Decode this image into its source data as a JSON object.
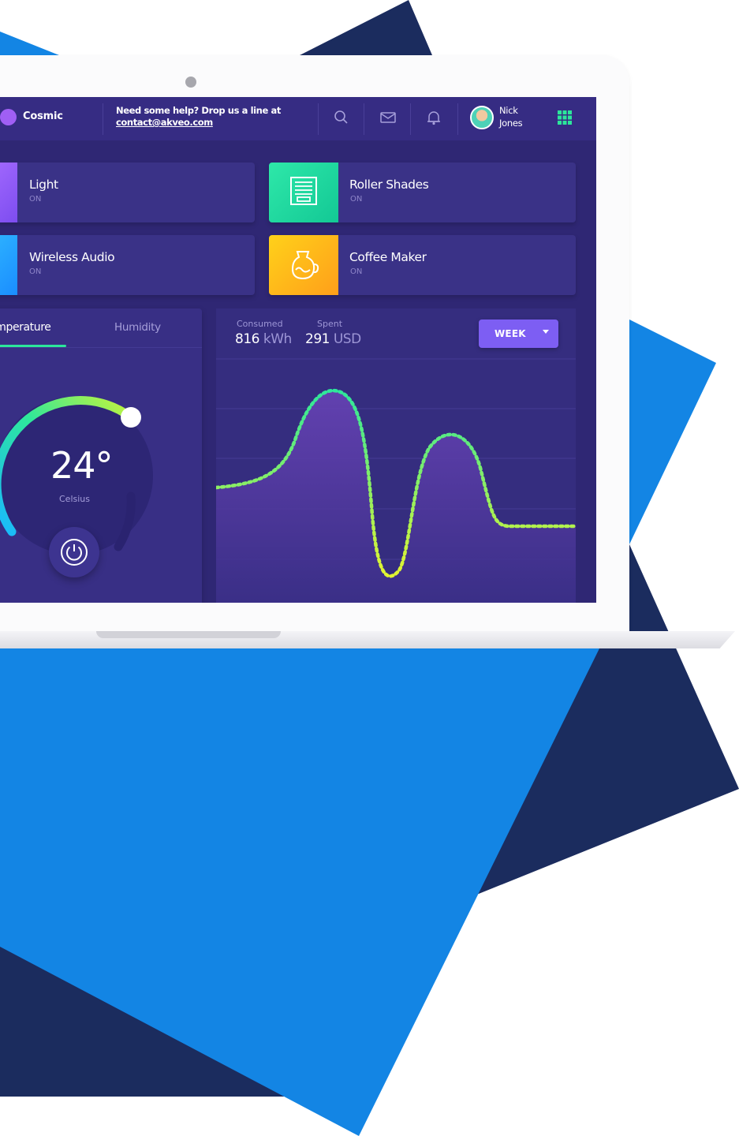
{
  "colors": {
    "background_blue": "#1385e4",
    "background_navy": "#1b2c5e",
    "screen": "#2f2774",
    "accent_purple": "#7d5ef3",
    "accent_green": "#2ce69b",
    "light_icon": "#9b59ff",
    "shades_icon": "#1dd8a1",
    "audio_icon": "#1aa3ff",
    "coffee_icon": "#ffb300"
  },
  "header": {
    "brand": "Cosmic",
    "help_line1": "Need some help? Drop us a line at",
    "help_email": "contact@akveo.com",
    "icons": [
      "search-icon",
      "mail-icon",
      "bell-icon",
      "grid-icon"
    ],
    "user_first": "Nick",
    "user_last": "Jones"
  },
  "devices": [
    {
      "name": "Light",
      "status": "ON",
      "icon": "bulb-icon"
    },
    {
      "name": "Roller Shades",
      "status": "ON",
      "icon": "shades-icon"
    },
    {
      "name": "Wireless Audio",
      "status": "ON",
      "icon": "speaker-icon"
    },
    {
      "name": "Coffee Maker",
      "status": "ON",
      "icon": "coffee-icon"
    }
  ],
  "thermostat": {
    "tab_active": "emperature",
    "tab_inactive": "Humidity",
    "value": "24°",
    "unit": "Celsius"
  },
  "consumption": {
    "consumed_label": "Consumed",
    "consumed_value": "816",
    "consumed_unit": "kWh",
    "spent_label": "Spent",
    "spent_value": "291",
    "spent_unit": "USD",
    "period": "WEEK"
  }
}
